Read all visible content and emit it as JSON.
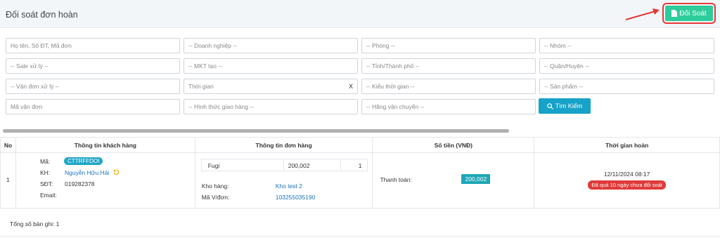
{
  "header": {
    "title": "Đối soát đơn hoàn",
    "doisoat_label": "Đối Soát"
  },
  "filters": {
    "name": "Họ tên, Số ĐT, Mã đơn",
    "company": "-- Doanh nghiệp --",
    "room": "-- Phòng --",
    "group": "-- Nhóm --",
    "sale": "-- Sale xử lý --",
    "mkt": "-- MKT tạo --",
    "province": "-- Tỉnh/Thành phố --",
    "district": "-- Quận/Huyện --",
    "shipper": "-- Vận đơn xử lý --",
    "time": "Thời gian",
    "time_clear": "X",
    "time_type": "-- Kiểu thời gian --",
    "product": "-- Sản phẩm --",
    "tracking": "Mã vận đơn",
    "delivery": "-- Hình thức giao hàng --",
    "carrier": "-- Hãng vận chuyển --",
    "search_label": "Tìm Kiếm"
  },
  "table": {
    "headers": [
      "No",
      "Thông tin khách hàng",
      "Thông tin đơn hàng",
      "Số tiền (VNĐ)",
      "Thời gian hoàn"
    ],
    "row": {
      "no": "1",
      "ma_label": "Mã:",
      "ma": "CTTRFFDOI",
      "kh_label": "KH:",
      "kh": "Nguyễn Hữu Hải",
      "sdt_label": "SĐT:",
      "sdt": "019282378",
      "email_label": "Email:",
      "product": "Fugi",
      "price": "200,002",
      "qty": "1",
      "kho_label": "Kho hàng:",
      "kho": "Kho test 2",
      "vd_label": "Mã V/đơn:",
      "vd": "103255035190",
      "pay_label": "Thanh toán:",
      "pay": "200,002",
      "time": "12/11/2024 08:17",
      "warning": "Đã quá 10 ngày chưa đối soát"
    }
  },
  "footer": {
    "total": "Tổng số bản ghi: 1"
  },
  "colors": {
    "accent": "#2ecc9a",
    "search": "#17a2c8",
    "warning": "#e03a3a",
    "highlight": "#e53935"
  }
}
